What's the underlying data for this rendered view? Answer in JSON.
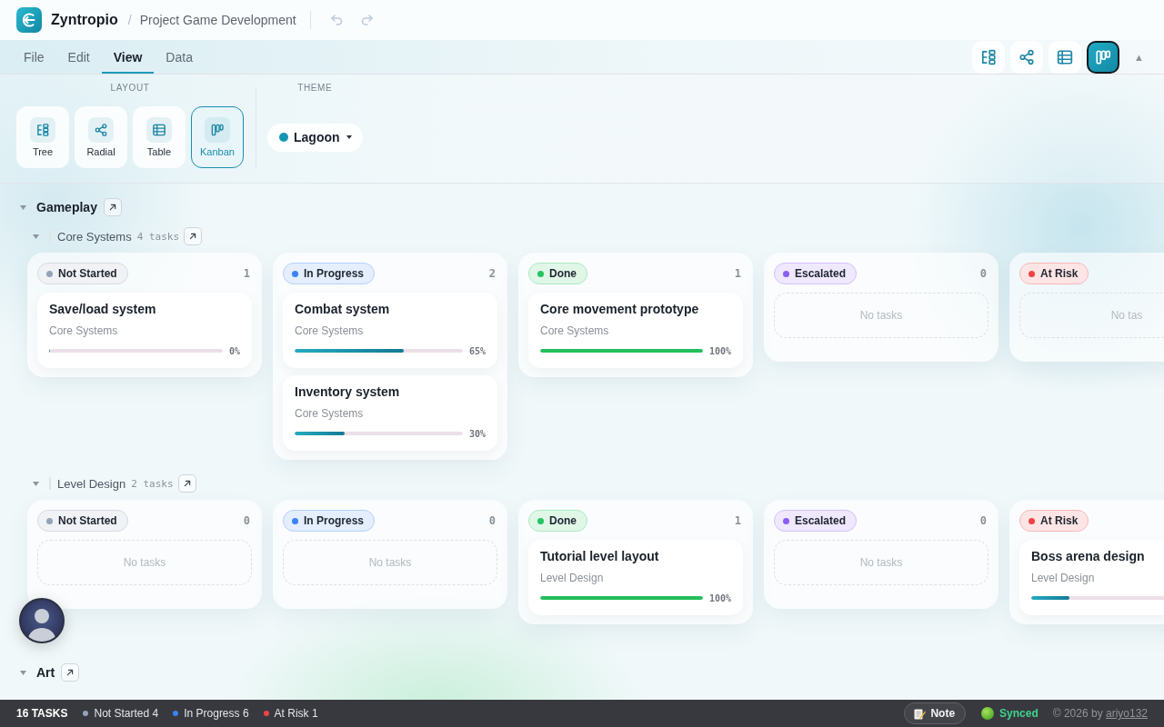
{
  "header": {
    "app_name": "Zyntropio",
    "separator": "/",
    "project": "Project Game Development",
    "undo": {
      "disabled": true
    },
    "redo": {
      "disabled": true
    }
  },
  "menu": {
    "tabs": [
      {
        "label": "File",
        "selected": false
      },
      {
        "label": "Edit",
        "selected": false
      },
      {
        "label": "View",
        "selected": true
      },
      {
        "label": "Data",
        "selected": false
      }
    ],
    "view_buttons": [
      {
        "kind": "tree",
        "selected": false
      },
      {
        "kind": "radial",
        "selected": false
      },
      {
        "kind": "table",
        "selected": false
      },
      {
        "kind": "kanban",
        "selected": true
      }
    ],
    "collapse_toggle": "▲"
  },
  "ribbon": {
    "layout": {
      "label": "LAYOUT",
      "options": [
        {
          "kind": "tree",
          "label": "Tree",
          "selected": false
        },
        {
          "kind": "radial",
          "label": "Radial",
          "selected": false
        },
        {
          "kind": "table",
          "label": "Table",
          "selected": false
        },
        {
          "kind": "kanban",
          "label": "Kanban",
          "selected": true
        }
      ]
    },
    "theme": {
      "label": "THEME",
      "value": "Lagoon"
    }
  },
  "board": {
    "groups": [
      {
        "title": "Gameplay",
        "expanded": true,
        "subgroups": [
          {
            "title": "Core Systems",
            "count": "4 tasks",
            "expanded": true,
            "columns": [
              {
                "status": "Not Started",
                "color": "#94a3b8",
                "count": "1",
                "cards": [
                  {
                    "title": "Save/load system",
                    "subtitle": "Core Systems",
                    "level": 0,
                    "percent": "0%"
                  }
                ]
              },
              {
                "status": "In Progress",
                "color": "#3b82f6",
                "count": "2",
                "cards": [
                  {
                    "title": "Combat system",
                    "subtitle": "Core Systems",
                    "level": 0.65,
                    "percent": "65%"
                  },
                  {
                    "title": "Inventory system",
                    "subtitle": "Core Systems",
                    "level": 0.3,
                    "percent": "30%"
                  }
                ]
              },
              {
                "status": "Done",
                "color": "#22c55e",
                "count": "1",
                "cards": [
                  {
                    "title": "Core movement prototype",
                    "subtitle": "Core Systems",
                    "level": 1,
                    "percent": "100%"
                  }
                ]
              },
              {
                "status": "Escalated",
                "color": "#8b5cf6",
                "count": "0",
                "empty_text": "No tasks"
              },
              {
                "status": "At Risk",
                "color": "#ef4444",
                "empty_text": "No tas"
              }
            ]
          },
          {
            "title": "Level Design",
            "count": "2 tasks",
            "expanded": true,
            "columns": [
              {
                "status": "Not Started",
                "color": "#94a3b8",
                "count": "0",
                "empty_text": "No tasks"
              },
              {
                "status": "In Progress",
                "color": "#3b82f6",
                "count": "0",
                "empty_text": "No tasks"
              },
              {
                "status": "Done",
                "color": "#22c55e",
                "count": "1",
                "cards": [
                  {
                    "title": "Tutorial level layout",
                    "subtitle": "Level Design",
                    "level": 1,
                    "percent": "100%"
                  }
                ]
              },
              {
                "status": "Escalated",
                "color": "#8b5cf6",
                "count": "0",
                "empty_text": "No tasks"
              },
              {
                "status": "At Risk",
                "color": "#ef4444",
                "cards": [
                  {
                    "title": "Boss arena design",
                    "subtitle": "Level Design",
                    "level": 0.2
                  }
                ]
              }
            ]
          }
        ]
      },
      {
        "title": "Art",
        "expanded": true
      }
    ]
  },
  "status_bar": {
    "total": "16 TASKS",
    "legend": [
      {
        "label": "Not Started 4",
        "color": "#94a3b8"
      },
      {
        "label": "In Progress 6",
        "color": "#3b82f6"
      },
      {
        "label": "At Risk 1",
        "color": "#ef4444"
      }
    ],
    "note_button": "Note",
    "sync": "Synced",
    "copyright": "© 2026 by",
    "author": "ariyo132"
  }
}
